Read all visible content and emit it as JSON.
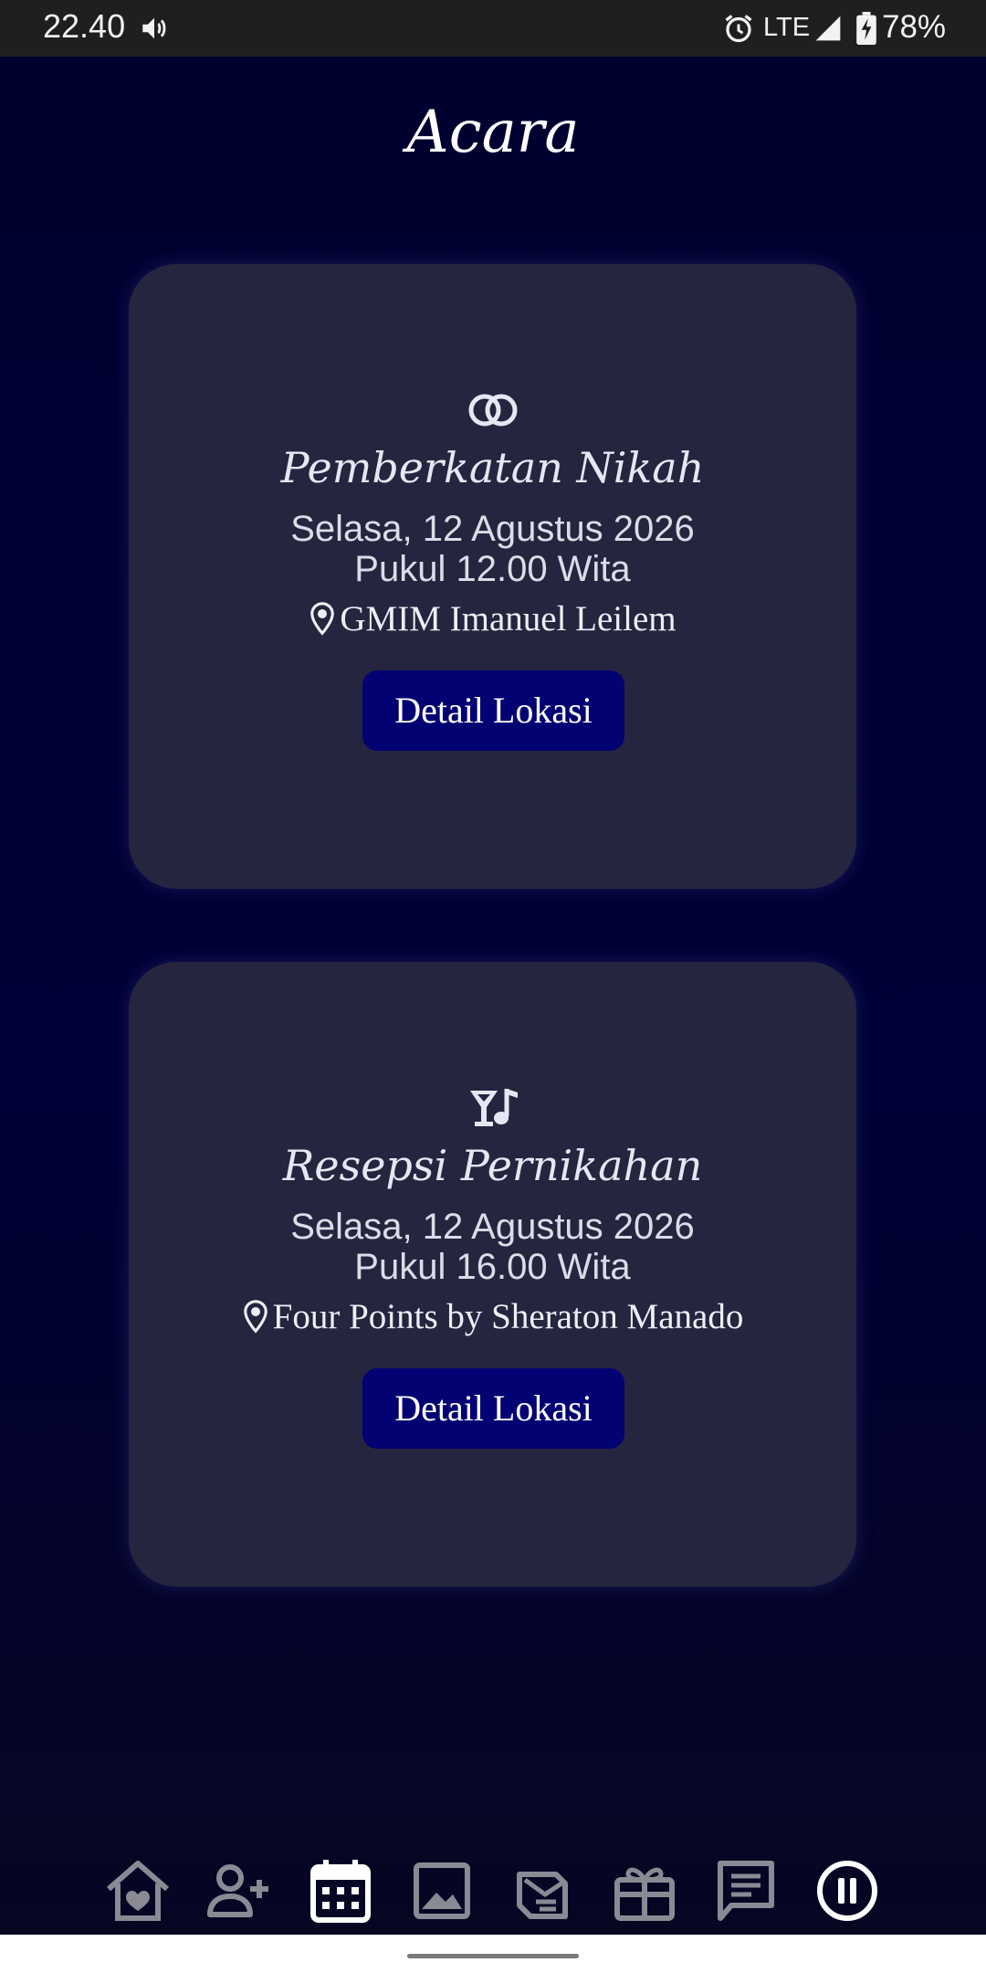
{
  "status_bar": {
    "time": "22.40",
    "network": "LTE",
    "battery": "78%"
  },
  "page": {
    "title": "Acara"
  },
  "events": [
    {
      "icon": "wedding-rings-icon",
      "title": "Pemberkatan Nikah",
      "date": "Selasa, 12 Agustus 2026",
      "time": "Pukul 12.00 Wita",
      "location": "GMIM Imanuel Leilem",
      "button_label": "Detail Lokasi"
    },
    {
      "icon": "cocktail-music-icon",
      "title": "Resepsi Pernikahan",
      "date": "Selasa, 12 Agustus 2026",
      "time": "Pukul 16.00 Wita",
      "location": "Four Points by Sheraton Manado",
      "button_label": "Detail Lokasi"
    }
  ],
  "bottom_nav": {
    "items": [
      "home-heart-icon",
      "person-add-icon",
      "calendar-icon",
      "image-icon",
      "letter-icon",
      "gift-icon",
      "comment-icon",
      "pause-icon"
    ],
    "active": "calendar-icon"
  },
  "colors": {
    "background": "#000033",
    "card": "#25253f",
    "button": "#020272",
    "text": "#ffffff"
  }
}
